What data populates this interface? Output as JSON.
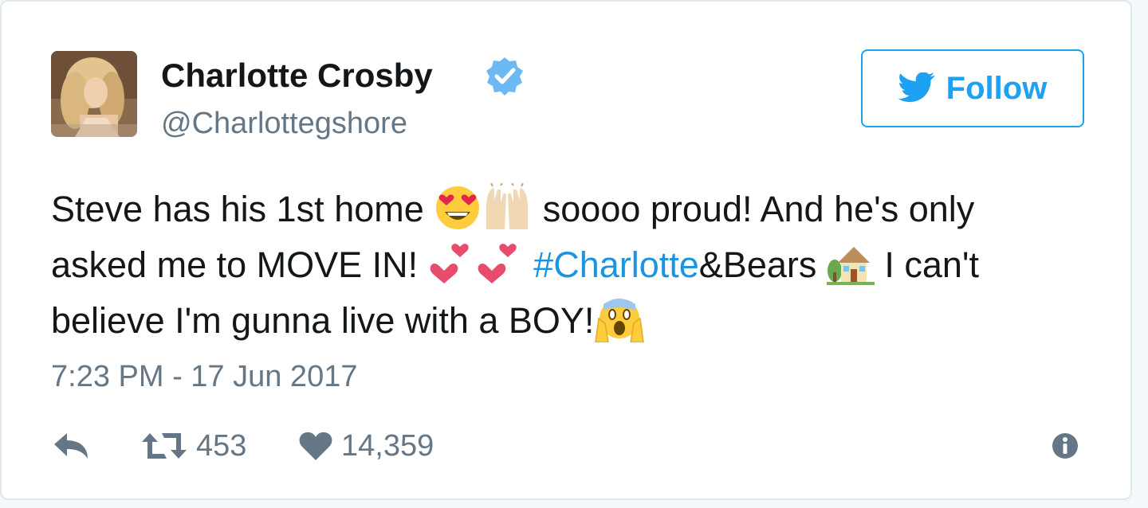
{
  "user": {
    "display_name": "Charlotte Crosby",
    "screen_name": "@Charlottegshore",
    "verified": true
  },
  "follow_button": {
    "label": "Follow",
    "icon": "twitter-bird-icon"
  },
  "tweet": {
    "line1": {
      "text_a": "Steve has his 1st home ",
      "emojis_a": [
        "heart-eyes-emoji",
        "raising-hands-emoji"
      ],
      "text_b": " soooo proud! And he's only"
    },
    "line2": {
      "text_a": "asked me to MOVE IN! ",
      "emojis_a": [
        "two-hearts-emoji",
        "two-hearts-emoji"
      ],
      "hashtag": "#Charlotte",
      "text_b": "&Bears ",
      "emojis_b": [
        "house-emoji"
      ],
      "text_c": " I can't"
    },
    "line3": {
      "text_a": "believe I'm gunna live with a BOY!",
      "emojis_a": [
        "screaming-face-emoji"
      ]
    },
    "timestamp": "7:23 PM - 17 Jun 2017"
  },
  "actions": {
    "reply_icon": "reply-icon",
    "retweet_icon": "retweet-icon",
    "retweet_count": "453",
    "like_icon": "heart-icon",
    "like_count": "14,359",
    "info_icon": "info-icon"
  },
  "colors": {
    "accent": "#1da1f2",
    "hashtag": "#1b95e0",
    "text": "#14171a",
    "muted": "#657786",
    "border": "#e1e8ed"
  }
}
